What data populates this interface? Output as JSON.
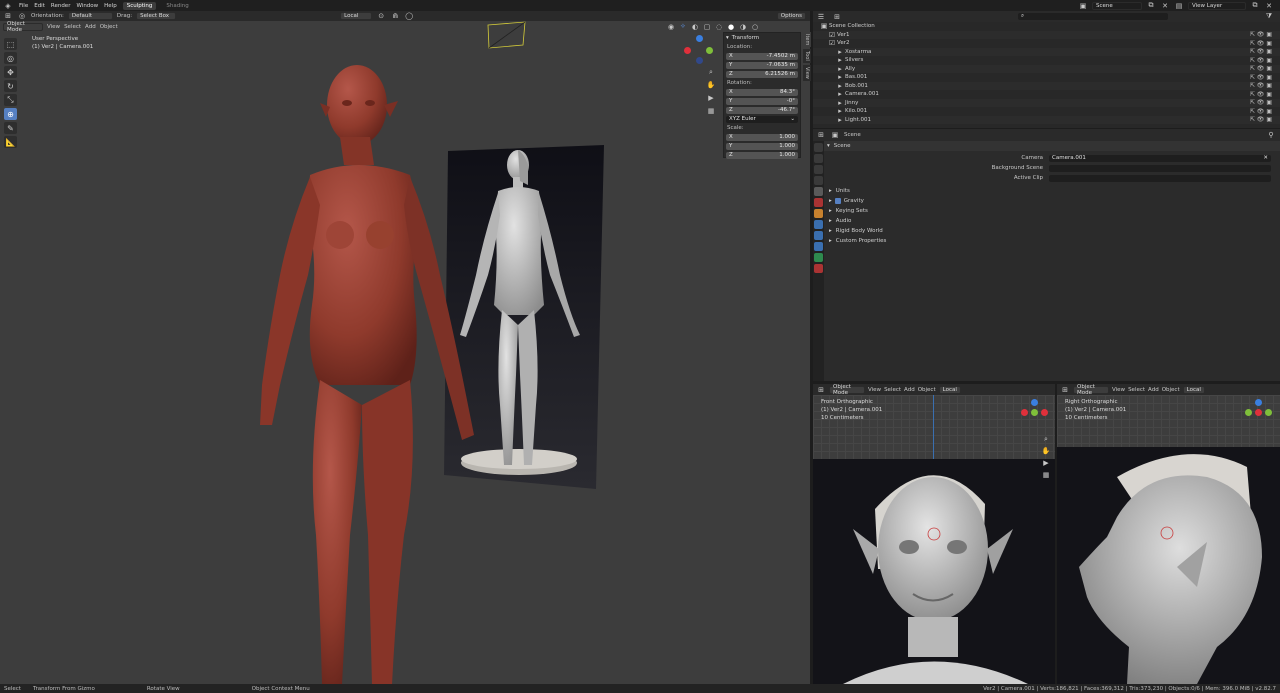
{
  "topbar": {
    "menus": [
      "File",
      "Edit",
      "Render",
      "Window",
      "Help"
    ],
    "workspaces": [
      "Sculpting",
      "Shading"
    ],
    "scene_label": "Scene",
    "view_layer_label": "View Layer"
  },
  "vp_header": {
    "orientation_label": "Orientation:",
    "orientation_value": "Default",
    "drag_label": "Drag:",
    "drag_value": "Select Box",
    "mode": "Object Mode",
    "menus": [
      "View",
      "Select",
      "Add",
      "Object"
    ],
    "transform_orientation": "Local",
    "options": "Options"
  },
  "viewport": {
    "perspective": "User Perspective",
    "collection": "(1) Ver2 | Camera.001"
  },
  "npanel": {
    "title": "Transform",
    "location_label": "Location:",
    "location": [
      {
        "axis": "X",
        "value": "-7.4502 m"
      },
      {
        "axis": "Y",
        "value": "-7.0635 m"
      },
      {
        "axis": "Z",
        "value": "6.21526 m"
      }
    ],
    "rotation_label": "Rotation:",
    "rotation": [
      {
        "axis": "X",
        "value": "84.3°"
      },
      {
        "axis": "Y",
        "value": "-0°"
      },
      {
        "axis": "Z",
        "value": "-46.7°"
      }
    ],
    "euler": "XYZ Euler",
    "scale_label": "Scale:",
    "scale": [
      {
        "axis": "X",
        "value": "1.000"
      },
      {
        "axis": "Y",
        "value": "1.000"
      },
      {
        "axis": "Z",
        "value": "1.000"
      }
    ],
    "tabs": [
      "Item",
      "Tool",
      "View"
    ]
  },
  "outliner": {
    "search_placeholder": "",
    "rows": [
      {
        "name": "Scene Collection",
        "depth": 0
      },
      {
        "name": "Ver1",
        "depth": 1
      },
      {
        "name": "Ver2",
        "depth": 1
      },
      {
        "name": "Xostarma",
        "depth": 2
      },
      {
        "name": "Silvers",
        "depth": 2
      },
      {
        "name": "Ally",
        "depth": 2
      },
      {
        "name": "Bas.001",
        "depth": 2
      },
      {
        "name": "Bob.001",
        "depth": 2
      },
      {
        "name": "Camera.001",
        "depth": 2
      },
      {
        "name": "Jinny",
        "depth": 2
      },
      {
        "name": "Kilo.001",
        "depth": 2
      },
      {
        "name": "Light.001",
        "depth": 2
      }
    ]
  },
  "properties": {
    "breadcrumb": "Scene",
    "panel_title": "Scene",
    "camera_label": "Camera",
    "camera_value": "Camera.001",
    "background_label": "Background Scene",
    "active_clip_label": "Active Clip",
    "sections": [
      "Units",
      "Gravity",
      "Keying Sets",
      "Audio",
      "Rigid Body World",
      "Custom Properties"
    ]
  },
  "view2": {
    "mode": "Object Mode",
    "menus": [
      "View",
      "Select",
      "Add",
      "Object"
    ],
    "orientation": "Local",
    "title": "Front Orthographic",
    "collection": "(1) Ver2 | Camera.001",
    "scale": "10 Centimeters"
  },
  "view3": {
    "mode": "Object Mode",
    "menus": [
      "View",
      "Select",
      "Add",
      "Object"
    ],
    "orientation": "Local",
    "title": "Right Orthographic",
    "collection": "(1) Ver2 | Camera.001",
    "scale": "10 Centimeters"
  },
  "status": {
    "select": "Select",
    "transform": "Transform From Gizmo",
    "rotate": "Rotate View",
    "context": "Object Context Menu",
    "stats": "Ver2 | Camera.001 | Verts:186,821 | Faces:369,312 | Tris:373,230 | Objects:0/6 | Mem: 396.0 MiB | v2.82.7"
  },
  "colors": {
    "skin": "#8f3a2c",
    "accent": "#5680c2",
    "clay": "#c9c9c9"
  }
}
